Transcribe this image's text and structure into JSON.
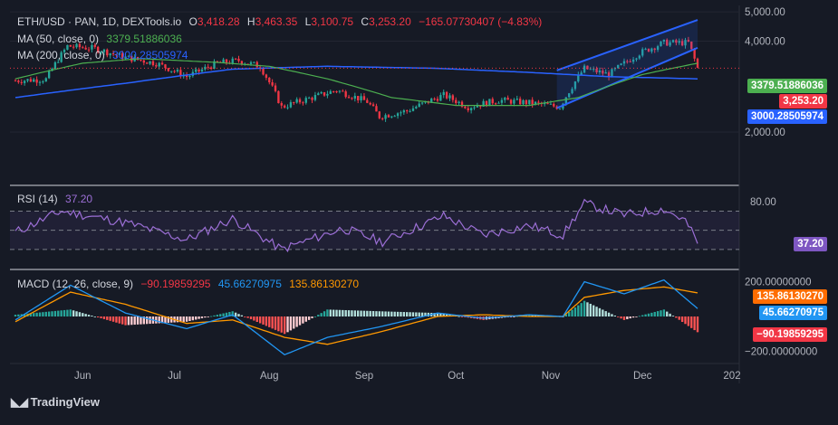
{
  "header": {
    "symbol": "ETH/USD · PAN, 1D, DEXTools.io",
    "open_label": "O",
    "open": "3,418.28",
    "high_label": "H",
    "high": "3,463.35",
    "low_label": "L",
    "low": "3,100.75",
    "close_label": "C",
    "close": "3,253.20",
    "change": "−165.07730407 (−4.83%)"
  },
  "ma50": {
    "label": "MA (50, close, 0)",
    "value": "3379.51886036",
    "color": "#4caf50"
  },
  "ma200": {
    "label": "MA (200, close, 0)",
    "value": "3000.28505974",
    "color": "#2962ff"
  },
  "rsi": {
    "label": "RSI (14)",
    "value": "37.20",
    "color": "#9c6fd6"
  },
  "macd": {
    "label": "MACD (12, 26, close, 9)",
    "hist": "−90.19859295",
    "macd_line": "45.66270975",
    "signal": "135.86130270"
  },
  "tags": {
    "ma50": "3379.51886036",
    "price": "3,253.20",
    "ma200": "3000.28505974",
    "rsi": "37.20",
    "macd_signal": "135.86130270",
    "macd_line": "45.66270975",
    "macd_hist": "−90.19859295"
  },
  "colors": {
    "up": "#26a69a",
    "down": "#f23645",
    "ma50": "#4caf50",
    "ma200": "#2962ff",
    "rsi": "#9c6fd6",
    "macd": "#2196f3",
    "signal": "#ff9800",
    "channel": "#2962ff"
  },
  "price_axis": {
    "ticks": [
      "5,000.00",
      "4,000.00",
      "2,000.00"
    ],
    "tick_values": [
      5000,
      4000,
      2000
    ],
    "range": [
      1350,
      5250
    ],
    "scale": "log"
  },
  "rsi_axis": {
    "ticks": [
      "80.00"
    ],
    "tick_values": [
      80
    ],
    "range": [
      10,
      95
    ],
    "bands": [
      70,
      50,
      30
    ]
  },
  "macd_axis": {
    "ticks": [
      "200.00000000",
      "−200.00000000"
    ],
    "tick_values": [
      200,
      -200
    ],
    "range": [
      -260,
      260
    ]
  },
  "time_axis": {
    "labels": [
      "Jun",
      "Jul",
      "Aug",
      "Sep",
      "Oct",
      "Nov",
      "Dec",
      "202"
    ]
  },
  "logo": "TradingView",
  "chart_data": {
    "type": "candlestick",
    "title": "ETH/USD · PAN, 1D, DEXTools.io",
    "timeframe": "1D",
    "price_series_anchors": {
      "dates": [
        "2024-05-10",
        "2024-05-20",
        "2024-05-27",
        "2024-06-05",
        "2024-06-15",
        "2024-06-25",
        "2024-07-05",
        "2024-07-15",
        "2024-07-22",
        "2024-07-29",
        "2024-08-05",
        "2024-08-15",
        "2024-08-23",
        "2024-09-02",
        "2024-09-06",
        "2024-09-15",
        "2024-09-27",
        "2024-10-05",
        "2024-10-15",
        "2024-10-25",
        "2024-11-04",
        "2024-11-12",
        "2024-11-20",
        "2024-11-30",
        "2024-12-08",
        "2024-12-16",
        "2024-12-19"
      ],
      "close": [
        2960,
        2990,
        3850,
        3780,
        3530,
        3380,
        3050,
        3380,
        3450,
        3300,
        2420,
        2600,
        2750,
        2520,
        2250,
        2350,
        2650,
        2420,
        2550,
        2500,
        2420,
        3250,
        3100,
        3650,
        3950,
        3950,
        3253.2
      ]
    },
    "ma50_anchors": {
      "dates": [
        "2024-05-10",
        "2024-06-01",
        "2024-06-20",
        "2024-07-15",
        "2024-08-01",
        "2024-08-20",
        "2024-09-10",
        "2024-10-01",
        "2024-10-25",
        "2024-11-10",
        "2024-12-01",
        "2024-12-19"
      ],
      "values": [
        3000,
        3380,
        3500,
        3400,
        3300,
        3000,
        2600,
        2450,
        2450,
        2600,
        3100,
        3379.51886036
      ]
    },
    "ma200_anchors": {
      "dates": [
        "2024-05-10",
        "2024-06-15",
        "2024-07-20",
        "2024-08-20",
        "2024-09-25",
        "2024-10-25",
        "2024-11-20",
        "2024-12-19"
      ],
      "values": [
        2600,
        2900,
        3230,
        3300,
        3250,
        3150,
        3050,
        3000.28505974
      ]
    },
    "channel": {
      "upper": [
        [
          "2024-11-03",
          3200
        ],
        [
          "2024-12-19",
          4700
        ]
      ],
      "lower": [
        [
          "2024-11-03",
          2400
        ],
        [
          "2024-12-19",
          3800
        ]
      ]
    },
    "rsi_anchors": {
      "dates": [
        "2024-05-10",
        "2024-05-25",
        "2024-06-15",
        "2024-07-05",
        "2024-07-20",
        "2024-08-05",
        "2024-08-25",
        "2024-09-07",
        "2024-09-27",
        "2024-10-10",
        "2024-10-25",
        "2024-11-05",
        "2024-11-12",
        "2024-11-25",
        "2024-12-08",
        "2024-12-15",
        "2024-12-19"
      ],
      "values": [
        48,
        70,
        58,
        40,
        62,
        30,
        52,
        38,
        65,
        45,
        55,
        45,
        78,
        66,
        72,
        60,
        37.2
      ]
    },
    "macd_anchors": {
      "dates": [
        "2024-05-10",
        "2024-05-28",
        "2024-06-15",
        "2024-07-05",
        "2024-07-20",
        "2024-08-06",
        "2024-08-20",
        "2024-09-06",
        "2024-09-25",
        "2024-10-10",
        "2024-10-25",
        "2024-11-05",
        "2024-11-12",
        "2024-11-25",
        "2024-12-08",
        "2024-12-19"
      ],
      "macd": [
        -20,
        180,
        20,
        -70,
        10,
        -220,
        -120,
        -60,
        20,
        -10,
        10,
        0,
        200,
        130,
        210,
        45.66270975
      ],
      "signal": [
        -30,
        140,
        70,
        -40,
        -20,
        -120,
        -160,
        -90,
        0,
        10,
        0,
        0,
        110,
        150,
        170,
        135.8613027
      ]
    }
  }
}
